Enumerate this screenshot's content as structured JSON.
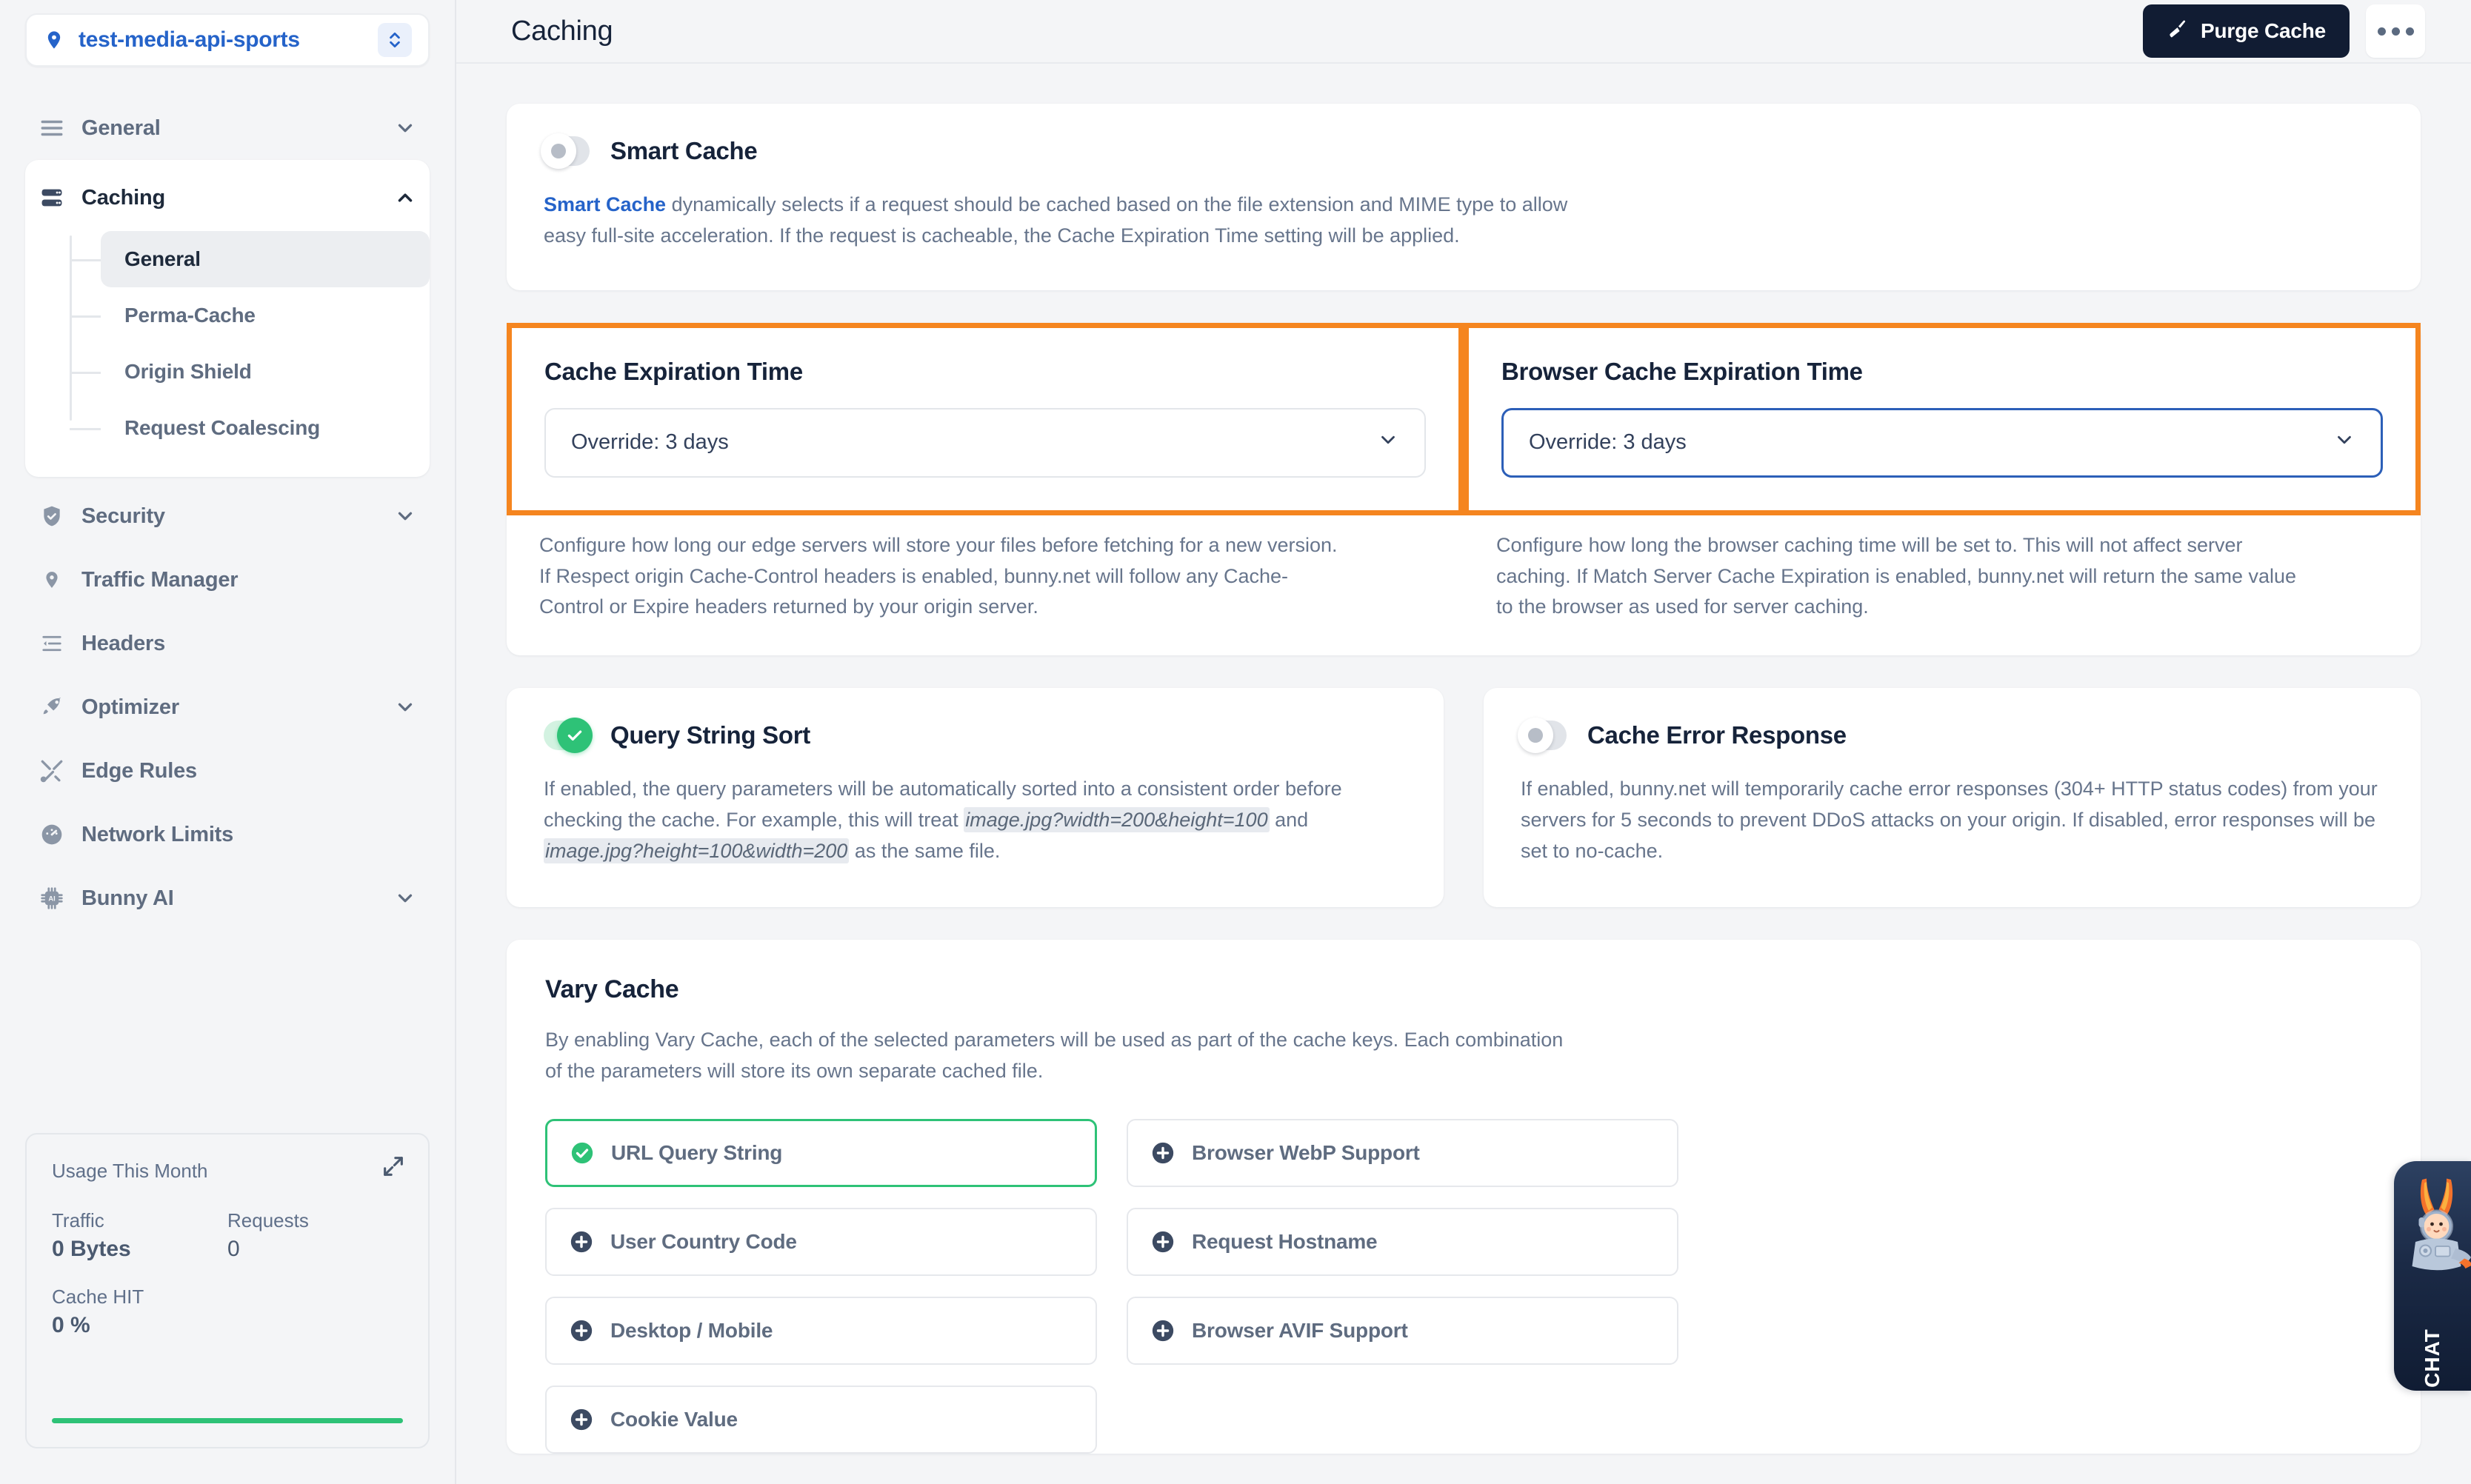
{
  "sidebar": {
    "project": {
      "name": "test-media-api-sports",
      "pin_icon": "location-pin-icon",
      "switch_icon": "chevron-up-down-icon"
    },
    "nav": [
      {
        "label": "General",
        "icon": "menu-lines-icon",
        "expandable": true,
        "expanded": false
      },
      {
        "label": "Caching",
        "icon": "server-stack-icon",
        "expandable": true,
        "expanded": true
      },
      {
        "label": "Security",
        "icon": "shield-check-icon",
        "expandable": true,
        "expanded": false
      },
      {
        "label": "Traffic Manager",
        "icon": "location-pin-icon",
        "expandable": false
      },
      {
        "label": "Headers",
        "icon": "headers-list-icon",
        "expandable": false
      },
      {
        "label": "Optimizer",
        "icon": "rocket-icon",
        "expandable": true,
        "expanded": false
      },
      {
        "label": "Edge Rules",
        "icon": "tools-icon",
        "expandable": false
      },
      {
        "label": "Network Limits",
        "icon": "gauge-icon",
        "expandable": false
      },
      {
        "label": "Bunny AI",
        "icon": "ai-chip-icon",
        "expandable": true,
        "expanded": false
      }
    ],
    "caching_sub": [
      {
        "label": "General",
        "active": true
      },
      {
        "label": "Perma-Cache",
        "active": false
      },
      {
        "label": "Origin Shield",
        "active": false
      },
      {
        "label": "Request Coalescing",
        "active": false
      }
    ],
    "usage": {
      "title": "Usage This Month",
      "expand_icon": "expand-arrows-icon",
      "traffic_label": "Traffic",
      "traffic_value": "0 Bytes",
      "requests_label": "Requests",
      "requests_value": "0",
      "cache_hit_label": "Cache HIT",
      "cache_hit_value": "0 %",
      "bar_color": "#2ec277"
    }
  },
  "topbar": {
    "title": "Caching",
    "purge_label": "Purge Cache",
    "purge_icon": "broom-icon",
    "more_icon": "ellipsis-icon"
  },
  "smart_cache": {
    "title": "Smart Cache",
    "enabled": false,
    "desc_link": "Smart Cache",
    "desc_rest": " dynamically selects if a request should be cached based on the file extension and MIME type to allow easy full-site acceleration. If the request is cacheable, the Cache Expiration Time setting will be applied."
  },
  "expiration": {
    "highlight_color": "#f5851f",
    "server": {
      "title": "Cache Expiration Time",
      "value": "Override: 3 days",
      "focused": false,
      "highlighted": true,
      "description": "Configure how long our edge servers will store your files before fetching for a new version. If Respect origin Cache-Control headers is enabled, bunny.net will follow any Cache-Control or Expire headers returned by your origin server."
    },
    "browser": {
      "title": "Browser Cache Expiration Time",
      "value": "Override: 3 days",
      "focused": true,
      "highlighted": true,
      "description": "Configure how long the browser caching time will be set to. This will not affect server caching. If Match Server Cache Expiration is enabled, bunny.net will return the same value to the browser as used for server caching."
    }
  },
  "query_string_sort": {
    "title": "Query String Sort",
    "enabled": true,
    "desc_1": "If enabled, the query parameters will be automatically sorted into a consistent order before checking the cache. For example, this will treat ",
    "code_1": "image.jpg?width=200&height=100",
    "desc_2": " and ",
    "code_2": "image.jpg?height=100&width=200",
    "desc_3": " as the same file."
  },
  "cache_error_response": {
    "title": "Cache Error Response",
    "enabled": false,
    "description": "If enabled, bunny.net will temporarily cache error responses (304+ HTTP status codes) from your servers for 5 seconds to prevent DDoS attacks on your origin. If disabled, error responses will be set to no-cache."
  },
  "vary_cache": {
    "title": "Vary Cache",
    "description": "By enabling Vary Cache, each of the selected parameters will be used as part of the cache keys. Each combination of the parameters will store its own separate cached file.",
    "options": [
      {
        "label": "URL Query String",
        "selected": true,
        "icon": "check-circle-icon"
      },
      {
        "label": "Browser WebP Support",
        "selected": false,
        "icon": "plus-circle-icon"
      },
      {
        "label": "User Country Code",
        "selected": false,
        "icon": "plus-circle-icon"
      },
      {
        "label": "Request Hostname",
        "selected": false,
        "icon": "plus-circle-icon"
      },
      {
        "label": "Desktop / Mobile",
        "selected": false,
        "icon": "plus-circle-icon"
      },
      {
        "label": "Browser AVIF Support",
        "selected": false,
        "icon": "plus-circle-icon"
      },
      {
        "label": "Cookie Value",
        "selected": false,
        "icon": "plus-circle-icon"
      }
    ]
  },
  "chat": {
    "label": "CHAT",
    "icon": "bunny-astronaut-icon"
  }
}
